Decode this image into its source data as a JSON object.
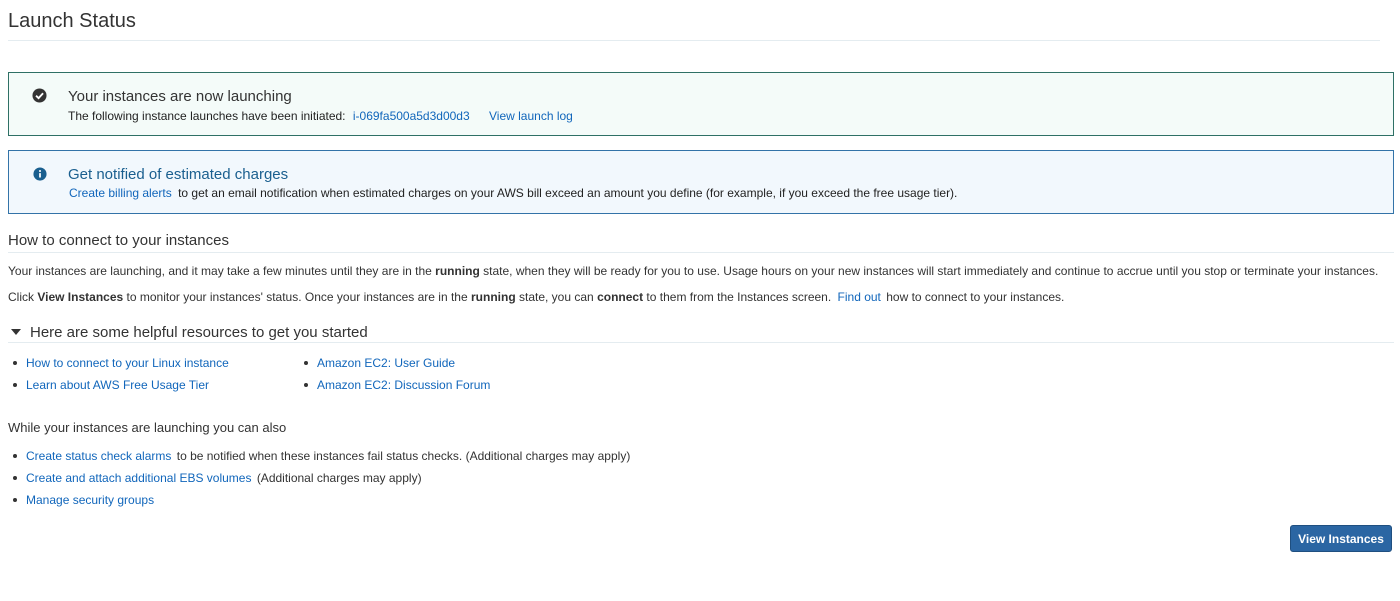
{
  "page": {
    "title": "Launch Status"
  },
  "success_notice": {
    "icon": "check-circle-icon",
    "title": "Your instances are now launching",
    "text": "The following instance launches have been initiated:",
    "instance_id": "i-069fa500a5d3d00d3",
    "log_link": "View launch log"
  },
  "info_notice": {
    "icon": "info-circle-icon",
    "title": "Get notified of estimated charges",
    "link": "Create billing alerts",
    "text": "to get an email notification when estimated charges on your AWS bill exceed an amount you define (for example, if you exceed the free usage tier)."
  },
  "connect": {
    "heading": "How to connect to your instances",
    "p1_a": "Your instances are launching, and it may take a few minutes until they are in the",
    "p1_b": "running",
    "p1_c": "state, when they will be ready for you to use. Usage hours on your new instances will start immediately and continue to accrue until you stop or terminate your instances.",
    "p2_a": "Click",
    "p2_b": "View Instances",
    "p2_c": "to monitor your instances' status. Once your instances are in the",
    "p2_d": "running",
    "p2_e": "state, you can",
    "p2_f": "connect",
    "p2_g": "to them from the Instances screen.",
    "p2_link": "Find out",
    "p2_h": "how to connect to your instances."
  },
  "resources": {
    "heading": "Here are some helpful resources to get you started",
    "col1": [
      "How to connect to your Linux instance",
      "Learn about AWS Free Usage Tier"
    ],
    "col2": [
      "Amazon EC2: User Guide",
      "Amazon EC2: Discussion Forum"
    ]
  },
  "also": {
    "heading": "While your instances are launching you can also",
    "item1_link": "Create status check alarms",
    "item1_text": "to be notified when these instances fail status checks. (Additional charges may apply)",
    "item2_link": "Create and attach additional EBS volumes",
    "item2_text": "(Additional charges may apply)",
    "item3_link": "Manage security groups"
  },
  "actions": {
    "view_instances": "View Instances"
  },
  "colors": {
    "accent": "#2b66a3",
    "link": "#1166bb",
    "success_border": "#2e7065",
    "info_border": "#3373a8"
  }
}
